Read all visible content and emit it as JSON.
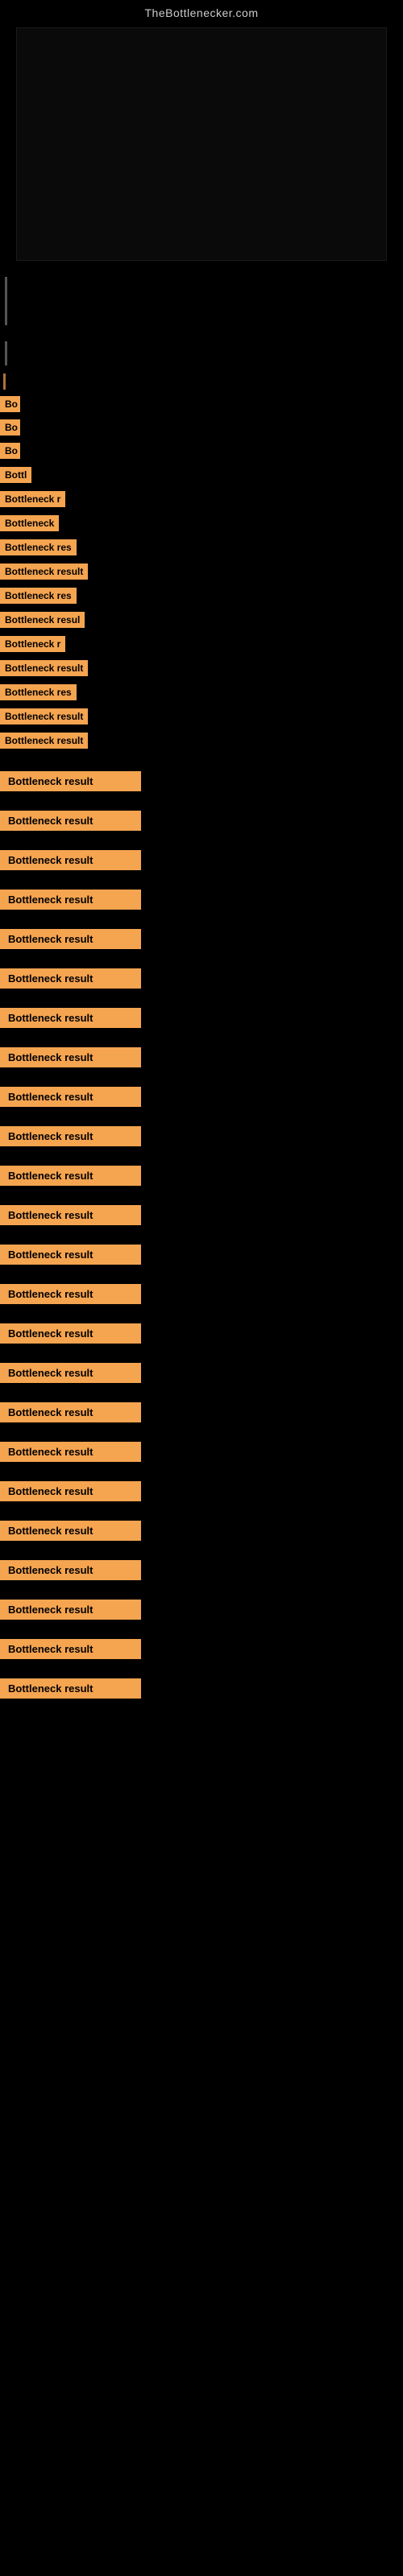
{
  "site": {
    "title": "TheBottlenecker.com"
  },
  "results": [
    {
      "label": "Bottleneck result",
      "width": 185,
      "gap_before": 88
    },
    {
      "label": "Bottleneck result",
      "width": 185,
      "gap_before": 14
    },
    {
      "label": "Bottleneck result",
      "width": 185,
      "gap_before": 14
    },
    {
      "label": "Bottleneck result",
      "width": 185,
      "gap_before": 14
    },
    {
      "label": "Bottleneck result",
      "width": 185,
      "gap_before": 14
    },
    {
      "label": "Bottleneck result",
      "width": 185,
      "gap_before": 14
    },
    {
      "label": "Bottleneck result",
      "width": 185,
      "gap_before": 14
    },
    {
      "label": "Bottleneck result",
      "width": 185,
      "gap_before": 14
    },
    {
      "label": "Bottleneck result",
      "width": 185,
      "gap_before": 14
    },
    {
      "label": "Bottleneck result",
      "width": 185,
      "gap_before": 14
    },
    {
      "label": "Bottleneck result",
      "width": 185,
      "gap_before": 14
    },
    {
      "label": "Bottleneck result",
      "width": 185,
      "gap_before": 14
    },
    {
      "label": "Bottleneck result",
      "width": 185,
      "gap_before": 14
    },
    {
      "label": "Bottleneck result",
      "width": 185,
      "gap_before": 14
    },
    {
      "label": "Bottleneck result",
      "width": 185,
      "gap_before": 14
    },
    {
      "label": "Bottleneck result",
      "width": 185,
      "gap_before": 14
    },
    {
      "label": "Bottleneck result",
      "width": 185,
      "gap_before": 14
    },
    {
      "label": "Bottleneck result",
      "width": 185,
      "gap_before": 14
    },
    {
      "label": "Bottleneck result",
      "width": 185,
      "gap_before": 14
    },
    {
      "label": "Bottleneck result",
      "width": 185,
      "gap_before": 14
    },
    {
      "label": "Bottleneck result",
      "width": 185,
      "gap_before": 14
    },
    {
      "label": "Bottleneck result",
      "width": 185,
      "gap_before": 14
    },
    {
      "label": "Bottleneck result",
      "width": 185,
      "gap_before": 14
    },
    {
      "label": "Bottleneck result",
      "width": 185,
      "gap_before": 14
    }
  ],
  "early_results": [
    {
      "label": "B",
      "width": 20,
      "gap_before": 0
    },
    {
      "label": "Bo",
      "width": 25,
      "gap_before": 0
    },
    {
      "label": "Bo",
      "width": 25,
      "gap_before": 0
    },
    {
      "label": "Bottl",
      "width": 45,
      "gap_before": 0
    },
    {
      "label": "Bottleneck r",
      "width": 90,
      "gap_before": 0
    },
    {
      "label": "Botteneck",
      "width": 75,
      "gap_before": 0
    },
    {
      "label": "Bottleneck res",
      "width": 108,
      "gap_before": 0
    },
    {
      "label": "Bottleneck result",
      "width": 130,
      "gap_before": 0
    },
    {
      "label": "Bottleneck res",
      "width": 108,
      "gap_before": 0
    },
    {
      "label": "Bottleneck resul",
      "width": 140,
      "gap_before": 0
    },
    {
      "label": "Bottleneck r",
      "width": 90,
      "gap_before": 0
    },
    {
      "label": "Bottleneck result",
      "width": 150,
      "gap_before": 0
    },
    {
      "label": "Bottleneck res",
      "width": 115,
      "gap_before": 0
    },
    {
      "label": "Bottleneck result",
      "width": 155,
      "gap_before": 0
    },
    {
      "label": "Bottleneck result",
      "width": 155,
      "gap_before": 0
    }
  ],
  "colors": {
    "background": "#000000",
    "result_bg": "#f5a450",
    "result_text": "#000000",
    "site_title": "#cccccc"
  }
}
